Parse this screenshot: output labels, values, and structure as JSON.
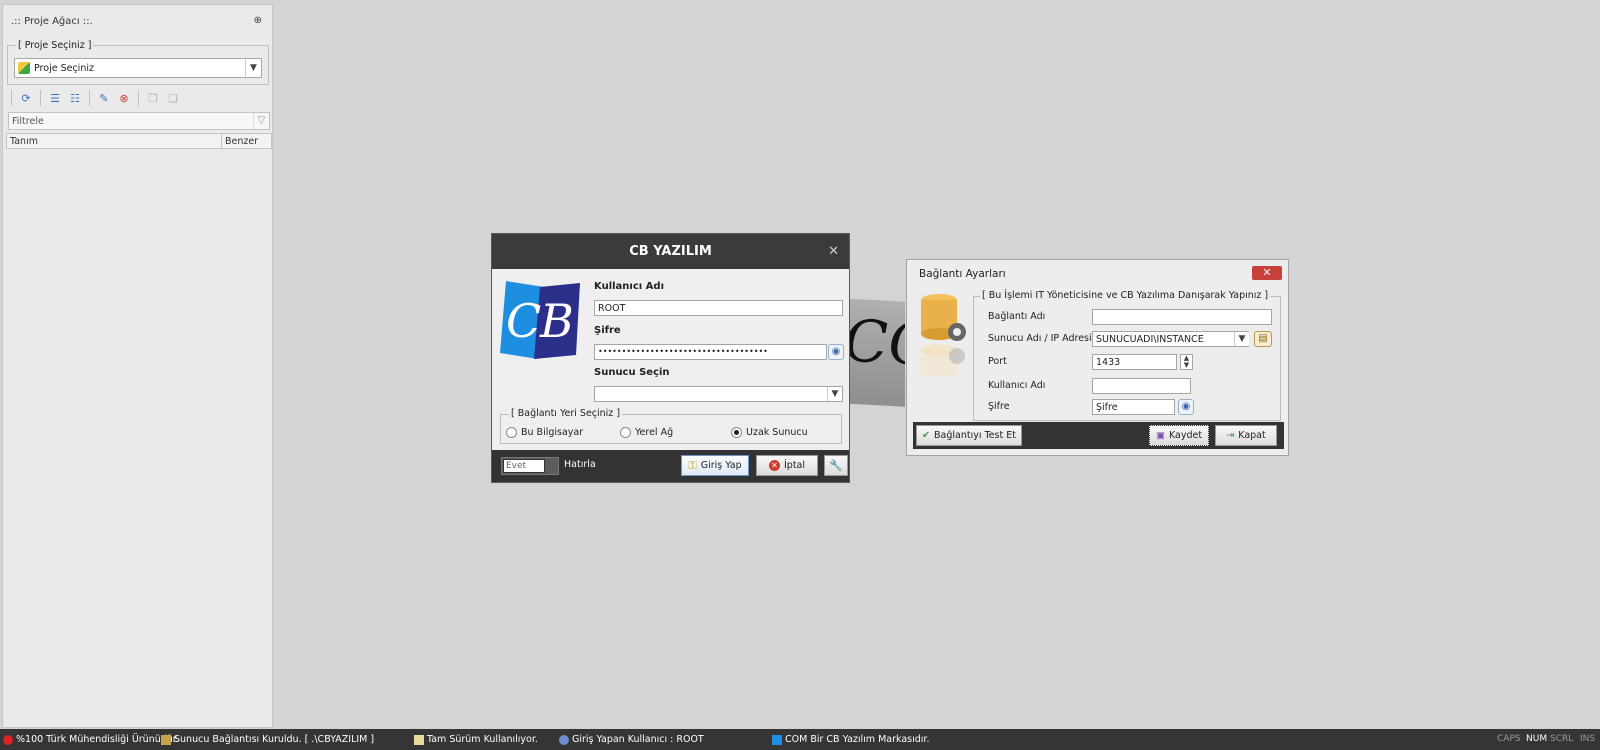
{
  "left_panel": {
    "title": ".:: Proje Ağacı ::.",
    "pin": "⊕",
    "project_group_legend": "[ Proje Seçiniz ]",
    "project_select_value": "Proje Seçiniz",
    "filter_text": "Filtrele",
    "columns": [
      "Tanım",
      "Benzer"
    ]
  },
  "login": {
    "title": "CB YAZILIM",
    "close": "✕",
    "username_label": "Kullanıcı Adı",
    "username_value": "ROOT",
    "password_label": "Şifre",
    "password_value": "••••••••••••••••••••••••••••••••••••",
    "server_label": "Sunucu Seçin",
    "server_value": "",
    "location_legend": "[ Bağlantı Yeri Seçiniz ]",
    "location_options": [
      "Bu Bilgisayar",
      "Yerel Ağ",
      "Uzak Sunucu"
    ],
    "location_selected": "Uzak Sunucu",
    "toggle_value": "Evet",
    "remember_label": "Hatırla",
    "login_button": "Giriş Yap",
    "cancel_button": "İptal"
  },
  "connection": {
    "title": "Bağlantı Ayarları",
    "close": "✕",
    "group_legend": "[ Bu İşlemi IT Yöneticisine ve CB Yazılıma Danışarak Yapınız ]",
    "conn_name_label": "Bağlantı Adı",
    "conn_name_value": "",
    "server_label": "Sunucu Adı / IP Adresi",
    "server_value": "SUNUCUADI\\INSTANCE",
    "port_label": "Port",
    "port_value": "1433",
    "user_label": "Kullanıcı Adı",
    "user_value": "",
    "password_label": "Şifre",
    "password_value": "Şifre",
    "test_button": "Bağlantıyı Test Et",
    "save_button": "Kaydet",
    "close_button": "Kapat"
  },
  "background_logo_text": "CO",
  "statusbar": {
    "items": [
      "%100 Türk Mühendisliği Ürünüdür.",
      "Sunucu Bağlantısı Kuruldu. [ .\\CBYAZILIM ]",
      "Tam Sürüm Kullanılıyor.",
      "Giriş Yapan Kullanıcı : ROOT",
      "COM Bir CB Yazılım Markasıdır."
    ],
    "keys": [
      "CAPS",
      "NUM",
      "SCRL",
      "INS"
    ]
  },
  "colors": {
    "titlebar": "#3b3b3b",
    "logo_blue": "#1d8ee0",
    "logo_navy": "#2b2f8a",
    "close_red": "#c9403a"
  }
}
